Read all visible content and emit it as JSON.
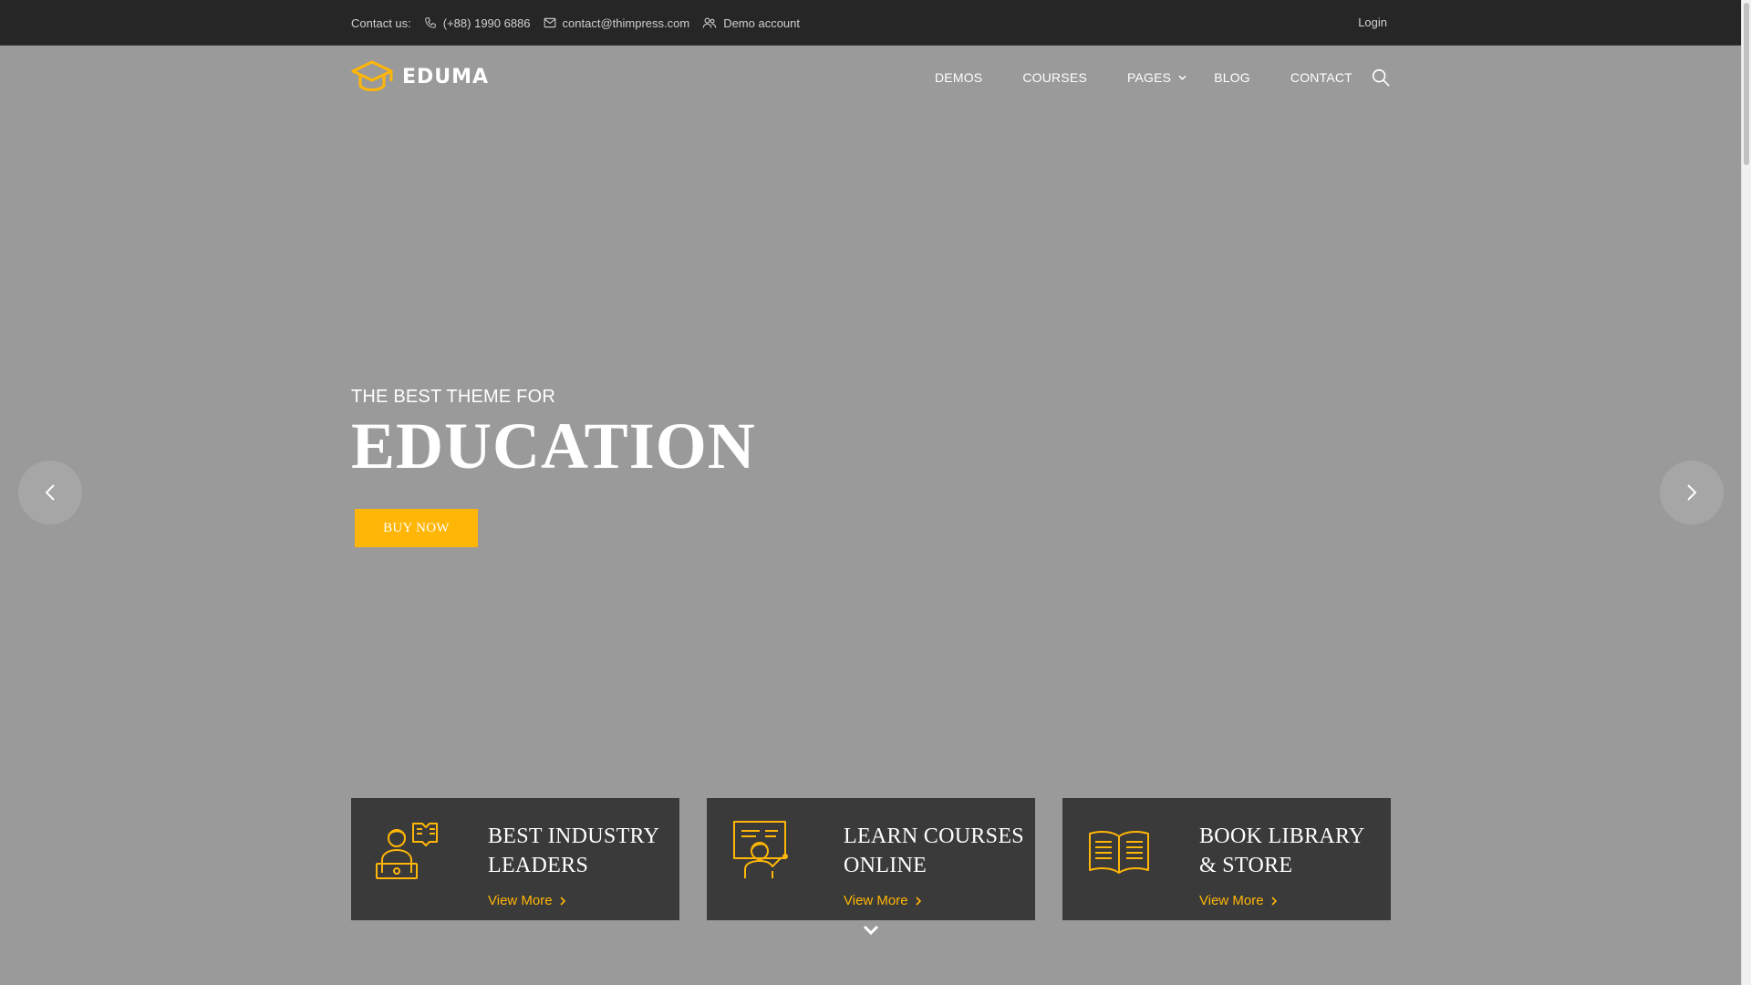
{
  "topbar": {
    "contact_label": "Contact us:",
    "phone": "(+88) 1990 6886",
    "email": "contact@thimpress.com",
    "demo": "Demo account",
    "login": "Login"
  },
  "header": {
    "logo_text": "EDUMA",
    "nav": [
      "DEMOS",
      "COURSES",
      "PAGES",
      "BLOG",
      "CONTACT"
    ]
  },
  "hero": {
    "kicker": "THE BEST THEME FOR",
    "headline": "EDUCATION",
    "cta": "BUY NOW"
  },
  "features": [
    {
      "title": "BEST INDUSTRY LEADERS",
      "link": "View More"
    },
    {
      "title": "LEARN COURSES ONLINE",
      "link": "View More"
    },
    {
      "title": "BOOK LIBRARY & STORE",
      "link": "View More"
    }
  ],
  "colors": {
    "accent": "#ffb606",
    "topbar": "#262626",
    "box": "#3a3a3a",
    "hero_bg": "#9a9a9a"
  },
  "icons": [
    "phone-icon",
    "mail-icon",
    "users-icon",
    "graduation-cap-icon",
    "chevron-down-icon",
    "search-icon",
    "arrow-left-icon",
    "arrow-right-icon",
    "leader-laptop-icon",
    "teacher-board-icon",
    "open-book-icon",
    "chevron-right-icon"
  ]
}
